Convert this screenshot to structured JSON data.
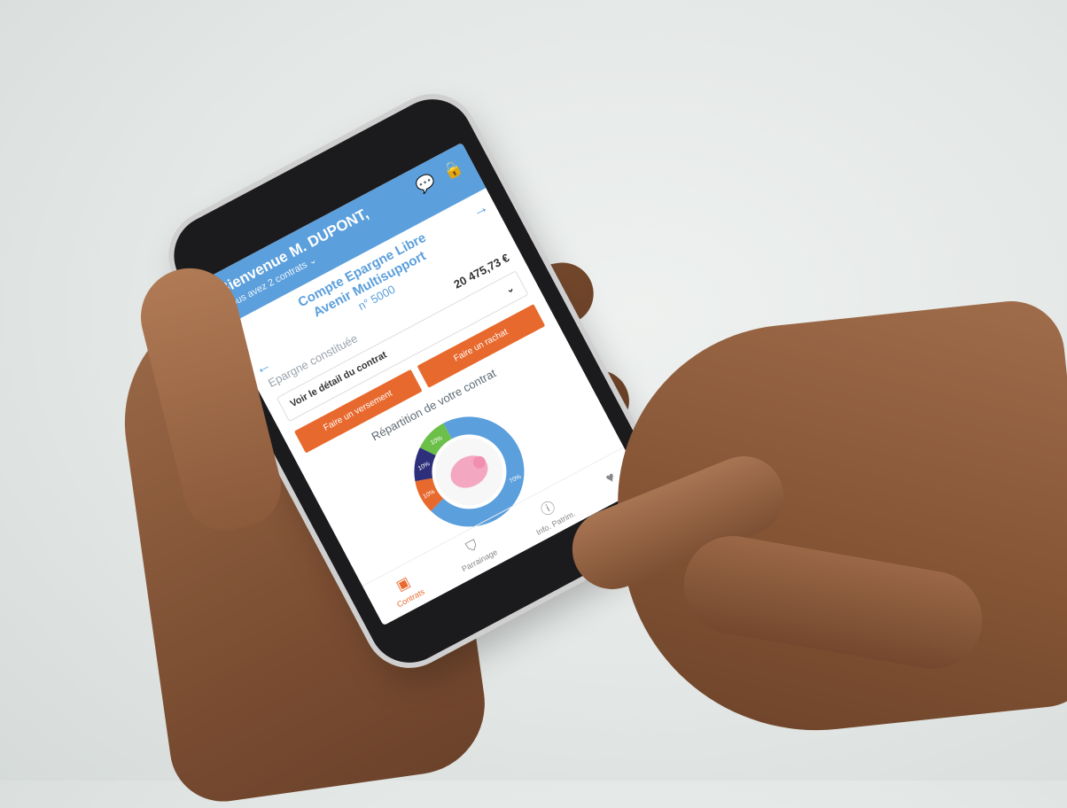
{
  "app": {
    "welcome": "Bienvenue M. DUPONT,",
    "contracts_count": "vous avez 2 contrats",
    "contract_title_line1": "Compte Epargne Libre",
    "contract_title_line2": "Avenir Multisupport",
    "contract_number": "n° 5000",
    "savings_label": "Epargne constituée",
    "savings_amount": "20 475,73 €",
    "detail_label": "Voir le détail du contrat",
    "btn_payment": "Faire un versement",
    "btn_withdraw": "Faire un rachat",
    "distribution_title": "Répartition de votre contrat"
  },
  "chart_data": {
    "type": "pie",
    "categories": [
      "70%",
      "10%",
      "10%",
      "10%"
    ],
    "values": [
      70,
      10,
      10,
      10
    ],
    "colors": [
      "#5b9fdc",
      "#e8692d",
      "#2d2f7a",
      "#6cc04a"
    ]
  },
  "tabs": [
    {
      "label": "Contrats",
      "icon": "contracts-icon",
      "active": true
    },
    {
      "label": "Parrainage",
      "icon": "shield-icon",
      "active": false
    },
    {
      "label": "Info. Patrim.",
      "icon": "info-icon",
      "active": false
    },
    {
      "label": "",
      "icon": "heart-icon",
      "active": false
    }
  ],
  "colors": {
    "header_blue": "#5b9fdc",
    "accent_orange": "#e8692d"
  }
}
